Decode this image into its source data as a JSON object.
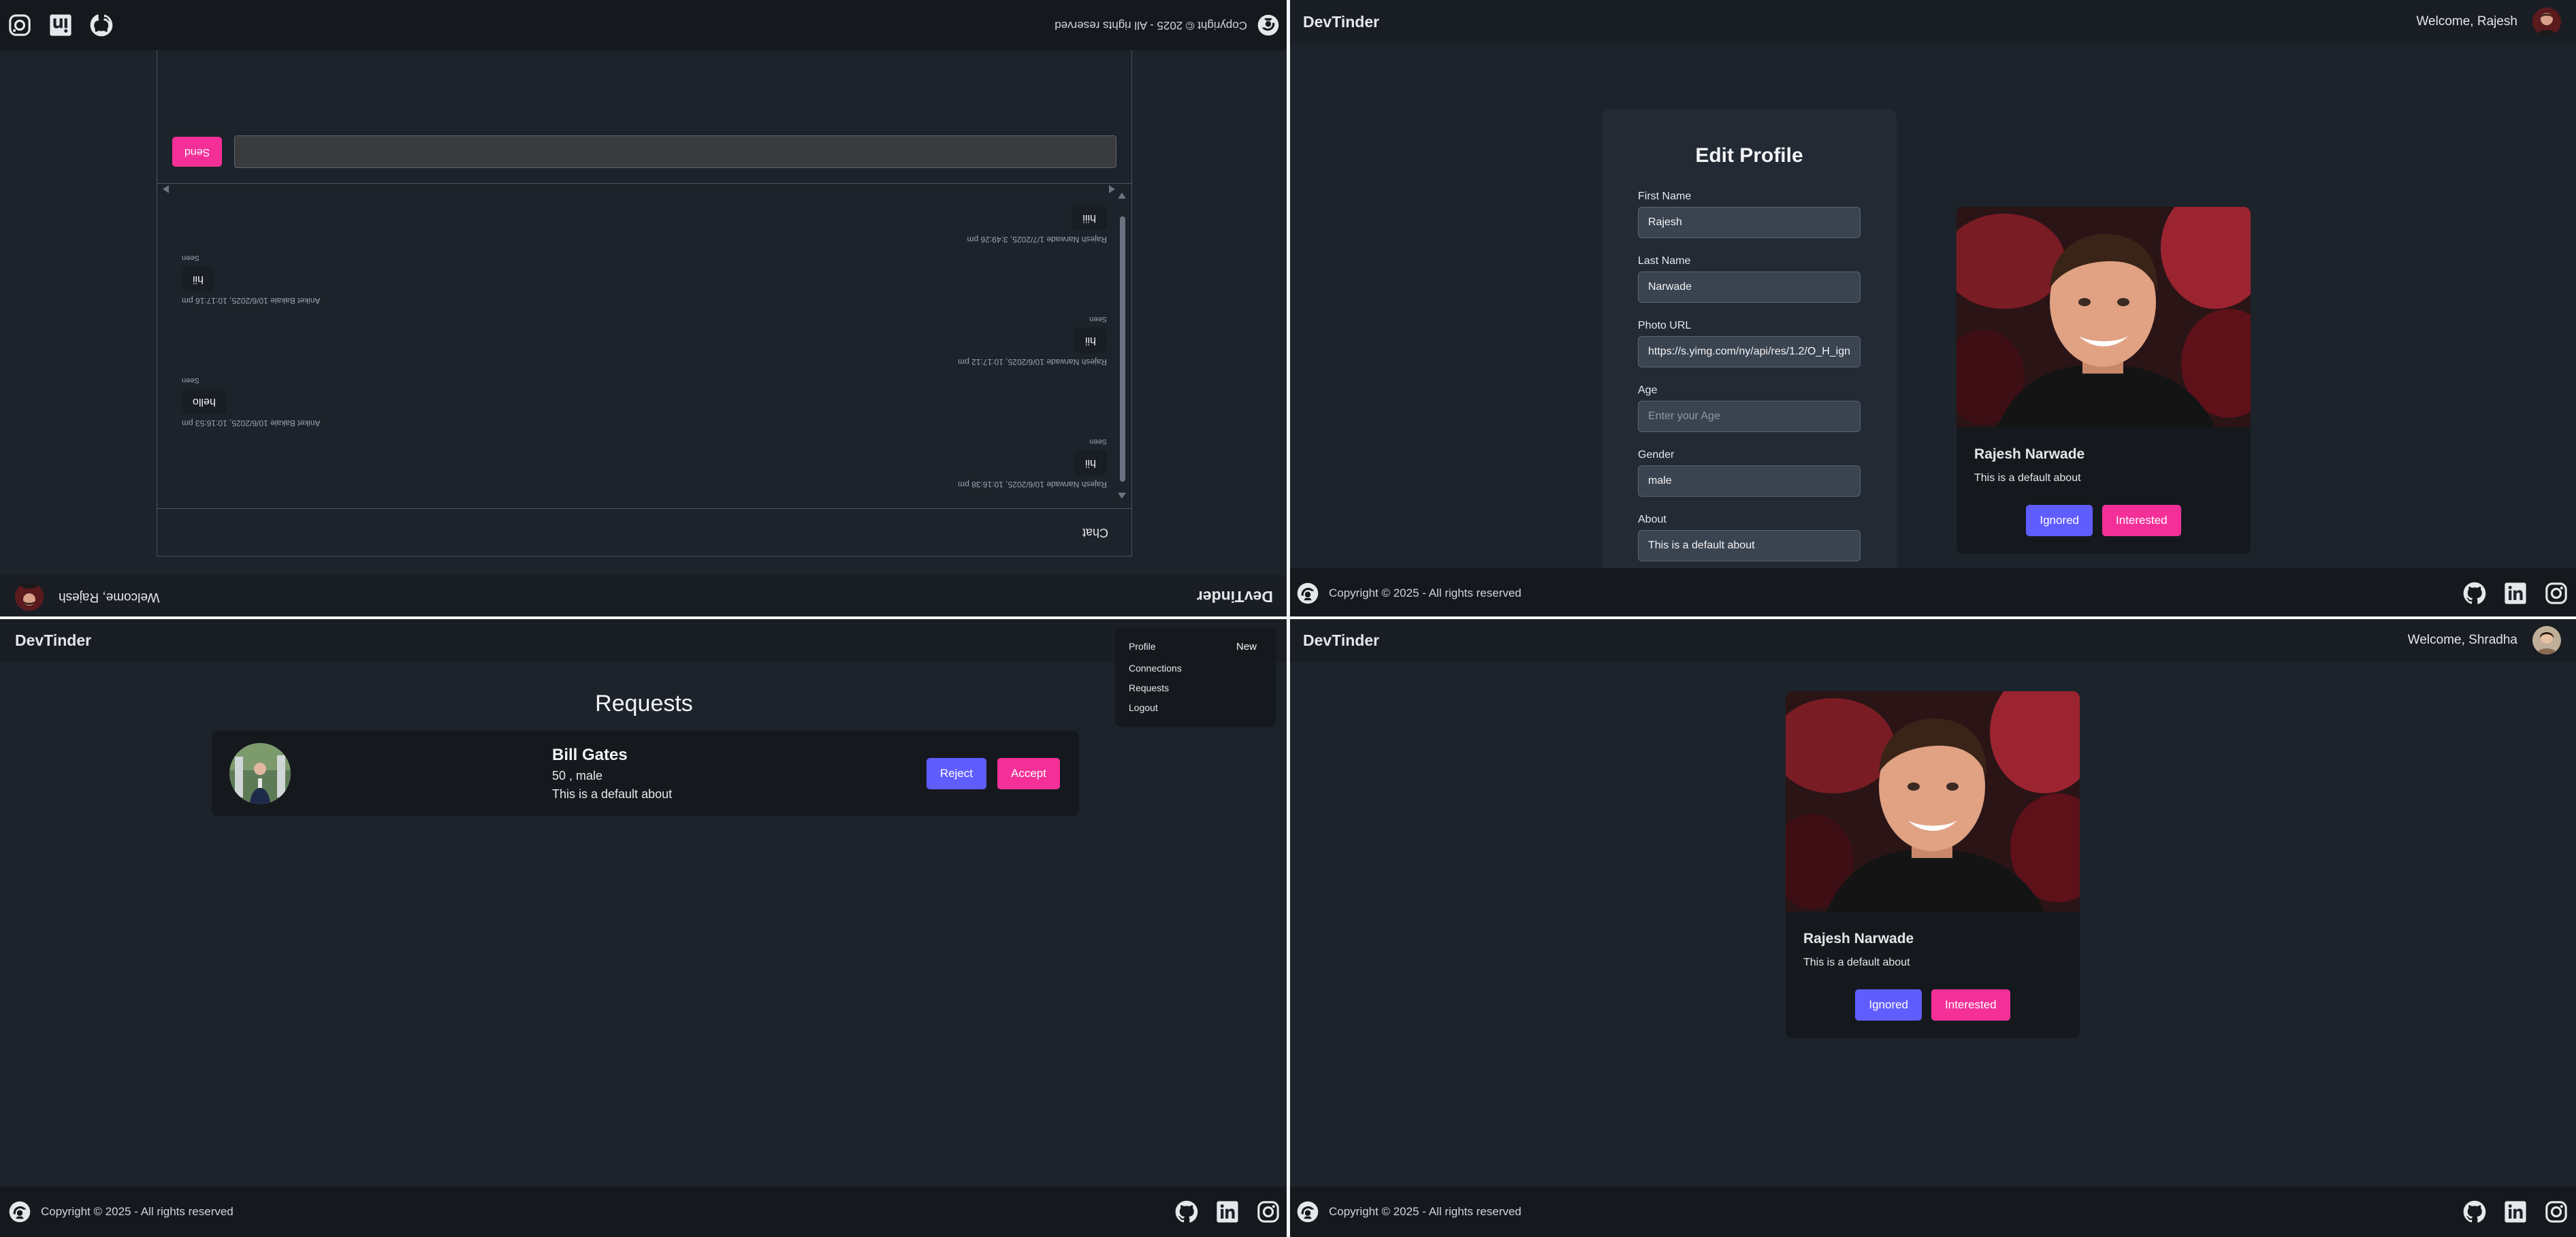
{
  "brand": "DevTinder",
  "colors": {
    "background": "#1d232a",
    "navbar": "#191e24",
    "card": "#15191e",
    "primary": "#605dff",
    "secondary": "#f43098"
  },
  "icons": {
    "footer_logo": "devtinder-logo-icon",
    "github": "github-icon",
    "linkedin": "linkedin-icon",
    "instagram": "instagram-icon"
  },
  "footer": {
    "copyright": "Copyright © 2025 - All rights reserved"
  },
  "top_left_chat": {
    "welcome": "Welcome, Rajesh",
    "chat_title": "Chat",
    "send_label": "Send",
    "messages": [
      {
        "meta": "Rajesh Narwade 10/6/2025, 10:16:38 pm",
        "text": "hii",
        "seen": "Seen"
      },
      {
        "meta": "Aniket Bakale 10/6/2025, 10:16:53 pm",
        "text": "hello",
        "seen": "Seen"
      },
      {
        "meta": "Rajesh Narwade 10/6/2025, 10:17:12 pm",
        "text": "hii",
        "seen": "Seen"
      },
      {
        "meta": "Aniket Bakale 10/6/2025, 10:17:16 pm",
        "text": "hii",
        "seen": "Seen"
      },
      {
        "meta": "Rajesh Narwade 1/7/2025, 3:49:26 pm",
        "text": "hiii",
        "seen": ""
      }
    ]
  },
  "top_right_edit": {
    "welcome": "Welcome, Rajesh",
    "title": "Edit Profile",
    "fields": {
      "first_name": {
        "label": "First Name",
        "value": "Rajesh"
      },
      "last_name": {
        "label": "Last Name",
        "value": "Narwade"
      },
      "photo_url": {
        "label": "Photo URL",
        "value": "https://s.yimg.com/ny/api/res/1.2/O_H_ign"
      },
      "age": {
        "label": "Age",
        "value": "",
        "placeholder": "Enter your Age"
      },
      "gender": {
        "label": "Gender",
        "value": "male"
      },
      "about": {
        "label": "About",
        "value": "This is a default about"
      }
    },
    "preview": {
      "name": "Rajesh Narwade",
      "about": "This is a default about",
      "ignored": "Ignored",
      "interested": "Interested"
    }
  },
  "bottom_left_requests": {
    "title": "Requests",
    "dropdown": {
      "profile": "Profile",
      "badge": "New",
      "connections": "Connections",
      "requests": "Requests",
      "logout": "Logout"
    },
    "request": {
      "name": "Bill Gates",
      "age_gender": "50 , male",
      "about": "This is a default about",
      "reject": "Reject",
      "accept": "Accept"
    }
  },
  "bottom_right_feed": {
    "welcome": "Welcome, Shradha",
    "card": {
      "name": "Rajesh Narwade",
      "about": "This is a default about",
      "ignored": "Ignored",
      "interested": "Interested"
    }
  }
}
